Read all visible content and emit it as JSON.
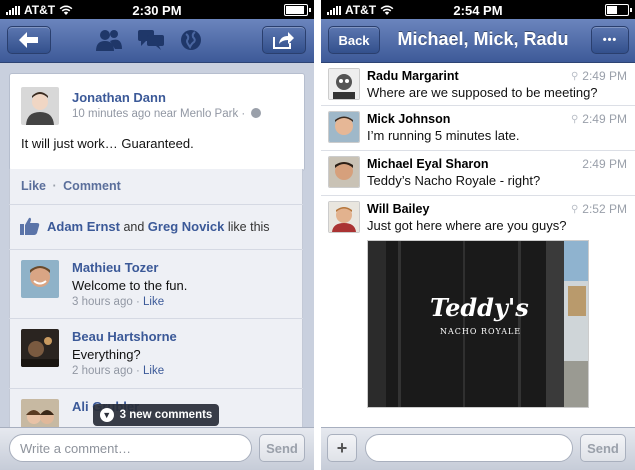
{
  "left_screen": {
    "status": {
      "carrier": "AT&T",
      "time": "2:30 PM"
    },
    "nav": {
      "back_icon": "back-arrow-icon",
      "icons": [
        "friends-icon",
        "messages-icon",
        "globe-icon"
      ],
      "share_icon": "share-icon"
    },
    "post": {
      "author": "Jonathan Dann",
      "meta": "10 minutes ago near Menlo Park ·",
      "text": "It will just work… Guaranteed.",
      "actions": {
        "like": "Like",
        "separator": "·",
        "comment": "Comment"
      }
    },
    "likes": {
      "user1": "Adam Ernst",
      "and": "and",
      "user2": "Greg Novick",
      "suffix": "like this"
    },
    "comments": [
      {
        "author": "Mathieu Tozer",
        "text": "Welcome to the fun.",
        "time": "3 hours ago",
        "sep": "·",
        "like": "Like"
      },
      {
        "author": "Beau Hartshorne",
        "text": "Everything?",
        "time": "2 hours ago",
        "sep": "·",
        "like": "Like"
      },
      {
        "author": "Ali Grubler",
        "text": ""
      }
    ],
    "toast": "3 new comments",
    "composer": {
      "placeholder": "Write a comment…",
      "send": "Send"
    }
  },
  "right_screen": {
    "status": {
      "carrier": "AT&T",
      "time": "2:54 PM"
    },
    "nav": {
      "back": "Back",
      "title": "Michael, Mick, Radu",
      "more": "•••"
    },
    "messages": [
      {
        "sender": "Radu Margarint",
        "time": "2:49 PM",
        "text": "Where are we supposed to be meeting?"
      },
      {
        "sender": "Mick Johnson",
        "time": "2:49 PM",
        "text": "I’m running 5 minutes late."
      },
      {
        "sender": "Michael Eyal Sharon",
        "time": "2:49 PM",
        "text": "Teddy’s Nacho Royale - right?"
      },
      {
        "sender": "Will Bailey",
        "time": "2:52 PM",
        "text": "Just got here where are you guys?"
      }
    ],
    "photo_sign": {
      "line1": "Teddy's",
      "line2": "NACHO ROYALE"
    },
    "composer": {
      "add": "+",
      "send": "Send"
    }
  }
}
